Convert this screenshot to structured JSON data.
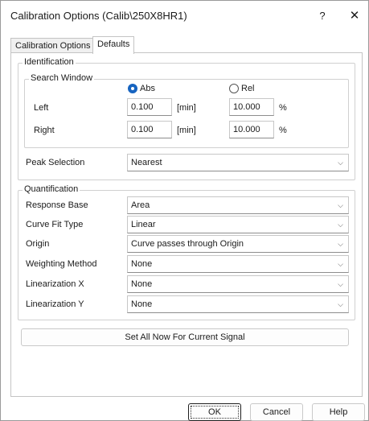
{
  "window": {
    "title": "Calibration Options (Calib\\250X8HR1)",
    "help_label": "?",
    "close_label": "✕"
  },
  "tabs": [
    {
      "label": "Calibration Options"
    },
    {
      "label": "Defaults"
    }
  ],
  "identification": {
    "label": "Identification",
    "search_window": {
      "label": "Search Window",
      "abs_label": "Abs",
      "rel_label": "Rel",
      "selected": "Abs",
      "left": {
        "label": "Left",
        "abs_value": "0.100",
        "unit": "[min]",
        "rel_value": "10.000",
        "percent": "%"
      },
      "right": {
        "label": "Right",
        "abs_value": "0.100",
        "unit": "[min]",
        "rel_value": "10.000",
        "percent": "%"
      }
    },
    "peak_selection": {
      "label": "Peak Selection",
      "value": "Nearest"
    }
  },
  "quantification": {
    "label": "Quantification",
    "response_base": {
      "label": "Response Base",
      "value": "Area"
    },
    "curve_fit_type": {
      "label": "Curve Fit Type",
      "value": "Linear"
    },
    "origin": {
      "label": "Origin",
      "value": "Curve passes through Origin"
    },
    "weighting_method": {
      "label": "Weighting Method",
      "value": "None"
    },
    "linearization_x": {
      "label": "Linearization X",
      "value": "None"
    },
    "linearization_y": {
      "label": "Linearization Y",
      "value": "None"
    }
  },
  "set_all_button": "Set All Now For Current Signal",
  "footer": {
    "ok": "OK",
    "cancel": "Cancel",
    "help": "Help"
  },
  "icons": {
    "dropdown": "chevron-down-icon"
  },
  "colors": {
    "accent": "#1764c0",
    "border": "#c4c4c4"
  }
}
